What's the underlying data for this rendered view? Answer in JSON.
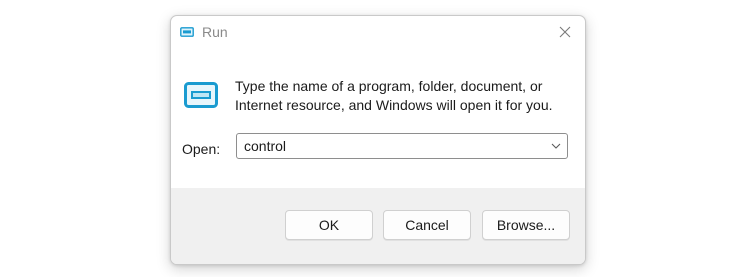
{
  "window": {
    "title": "Run",
    "close_icon": "close-icon"
  },
  "message": {
    "line1": "Type the name of a program, folder, document, or",
    "line2": "Internet resource, and Windows will open it for you."
  },
  "open_field": {
    "label": "Open:",
    "value": "control"
  },
  "buttons": {
    "ok": "OK",
    "cancel": "Cancel",
    "browse": "Browse..."
  },
  "colors": {
    "accent": "#1a9bd0",
    "footer": "#f0f0f0"
  }
}
